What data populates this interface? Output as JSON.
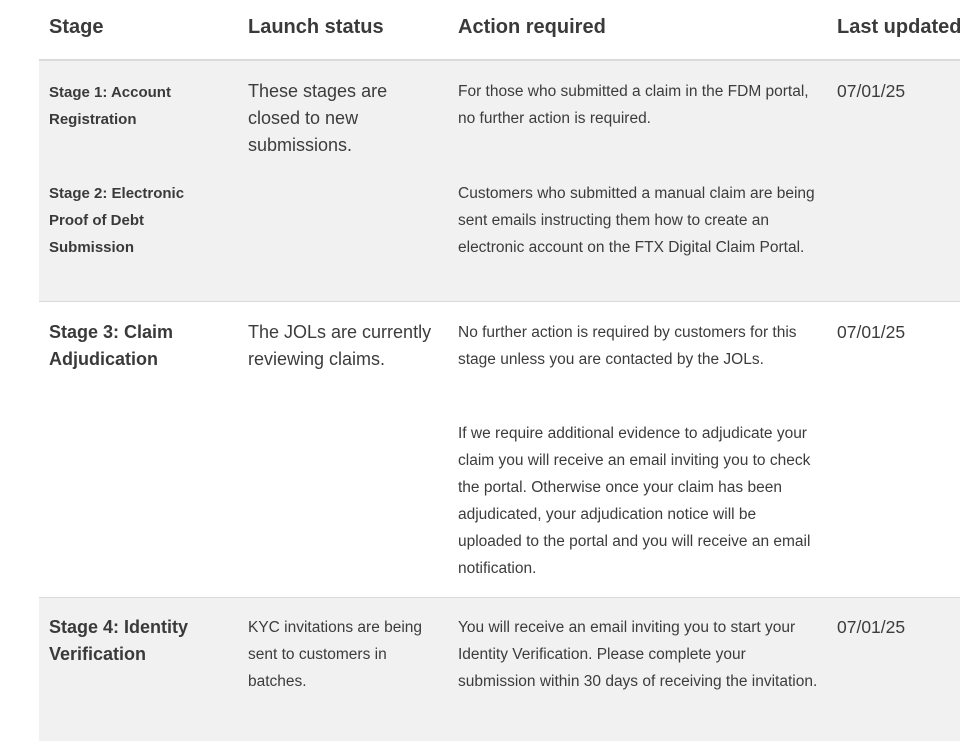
{
  "columns": {
    "stage": "Stage",
    "status": "Launch status",
    "action": "Action required",
    "updated": "Last updated"
  },
  "rows": [
    {
      "stage_a": "Stage 1: Account Registration",
      "stage_b": "Stage 2: Electronic Proof of Debt Submission",
      "status": "These stages are closed to new submissions.",
      "action_a": "For those who submitted a claim in the FDM portal, no further action is required.",
      "action_b": "Customers who submitted a manual claim are being sent emails instructing them how to create an electronic account on the FTX Digital Claim Portal.",
      "updated": "07/01/25"
    },
    {
      "stage": "Stage 3:  Claim Adjudication",
      "status": "The JOLs are currently reviewing claims.",
      "action_a": "No further action is required by customers for this stage unless you are contacted by the JOLs.",
      "action_b": "If we require additional evidence to adjudicate your claim you will receive an email inviting you to check the portal. Otherwise once your claim has been adjudicated, your adjudication notice will be uploaded to the portal and you will receive an email notification.",
      "updated": "07/01/25"
    },
    {
      "stage": "Stage 4: Identity Verification",
      "status": "KYC invitations are being sent to customers in batches.",
      "action": "You will receive an email inviting you to start your Identity Verification. Please complete your submission within 30 days of receiving the invitation.",
      "updated": "07/01/25"
    }
  ]
}
